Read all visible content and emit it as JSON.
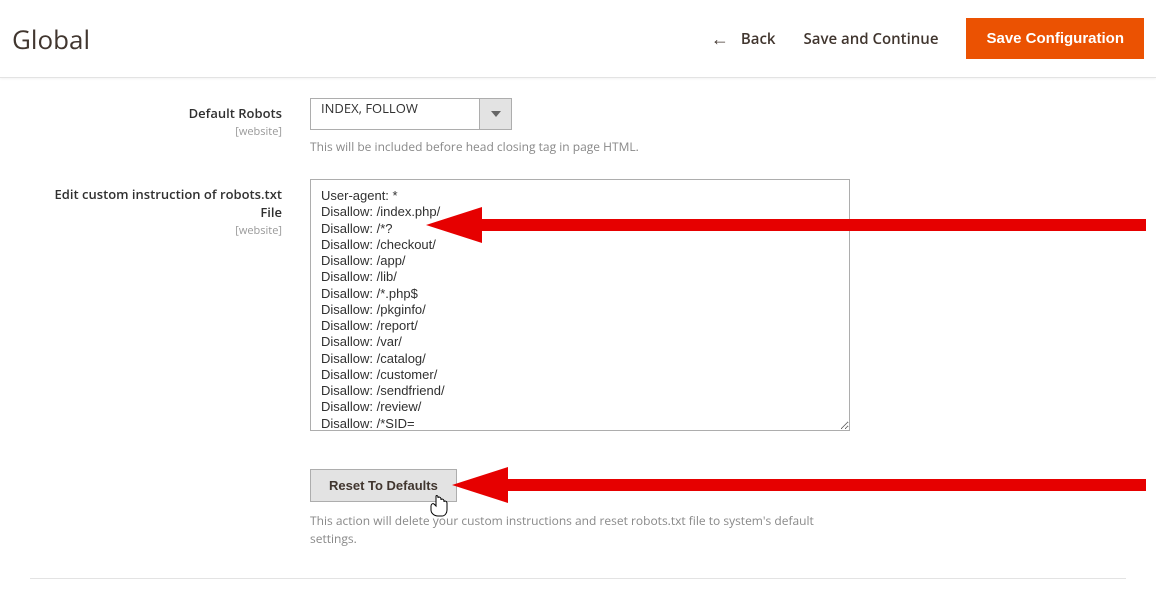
{
  "header": {
    "title": "Global",
    "back_label": "Back",
    "save_continue_label": "Save and Continue",
    "save_config_label": "Save Configuration"
  },
  "fields": {
    "default_robots": {
      "label": "Default Robots",
      "scope": "[website]",
      "value": "INDEX, FOLLOW",
      "help": "This will be included before head closing tag in page HTML."
    },
    "robots_txt": {
      "label": "Edit custom instruction of robots.txt File",
      "scope": "[website]",
      "value": "User-agent: *\nDisallow: /index.php/\nDisallow: /*?\nDisallow: /checkout/\nDisallow: /app/\nDisallow: /lib/\nDisallow: /*.php$\nDisallow: /pkginfo/\nDisallow: /report/\nDisallow: /var/\nDisallow: /catalog/\nDisallow: /customer/\nDisallow: /sendfriend/\nDisallow: /review/\nDisallow: /*SID="
    },
    "reset": {
      "button_label": "Reset To Defaults",
      "help": "This action will delete your custom instructions and reset robots.txt file to system's default settings."
    }
  }
}
